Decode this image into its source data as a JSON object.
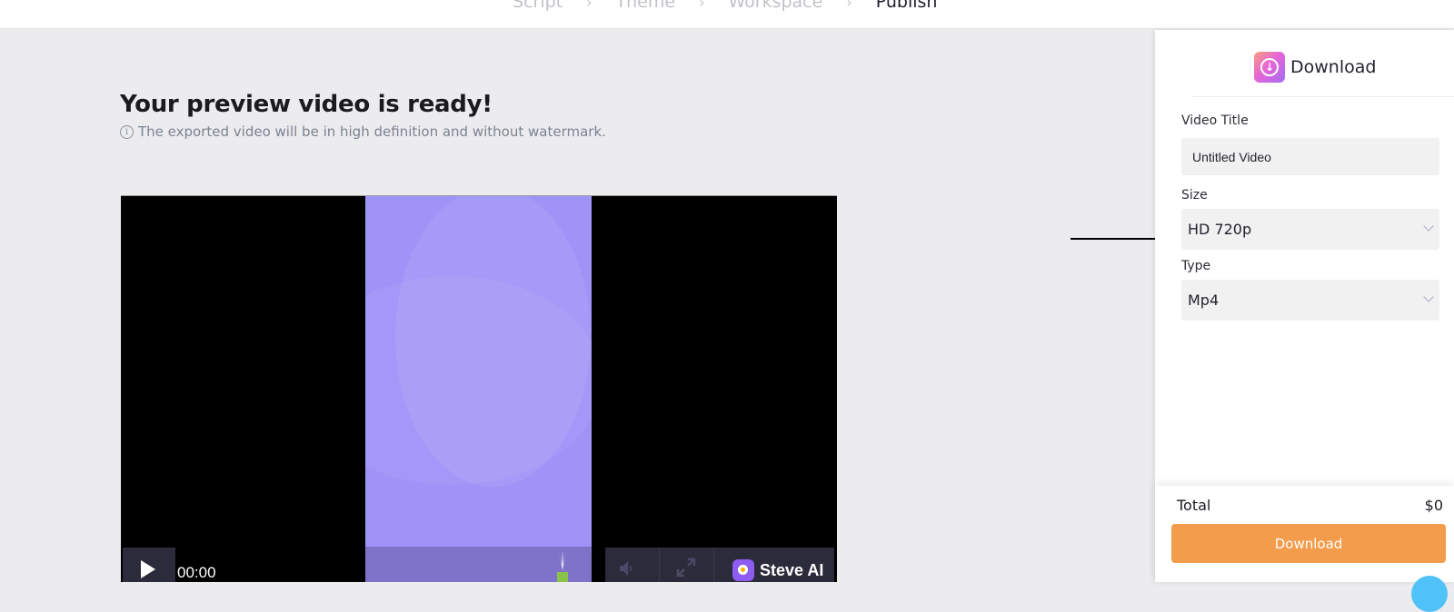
{
  "stepper": {
    "steps": [
      {
        "label": "Script",
        "active": false
      },
      {
        "label": "Theme",
        "active": false
      },
      {
        "label": "Workspace",
        "active": false
      },
      {
        "label": "Publish",
        "active": true
      }
    ],
    "separator": "›"
  },
  "main": {
    "title": "Your preview video is ready!",
    "info_icon": "i",
    "subtitle": "The exported video will be in high definition and without watermark."
  },
  "player": {
    "time": "00:00",
    "brand": "Steve AI",
    "icons": [
      "play-icon",
      "volume-icon",
      "fullscreen-icon"
    ]
  },
  "panel": {
    "title": "Download",
    "icon": "download-icon",
    "video_title_label": "Video Title",
    "video_title_value": "Untitled Video",
    "size_label": "Size",
    "size_value": "HD 720p",
    "type_label": "Type",
    "type_value": "Mp4"
  },
  "footer": {
    "total_label": "Total",
    "total_value": "$0",
    "download_button": "Download",
    "button_color": "#f39c4b"
  },
  "colors": {
    "frame": "#9f93f7",
    "accent": "#f39c4b"
  }
}
